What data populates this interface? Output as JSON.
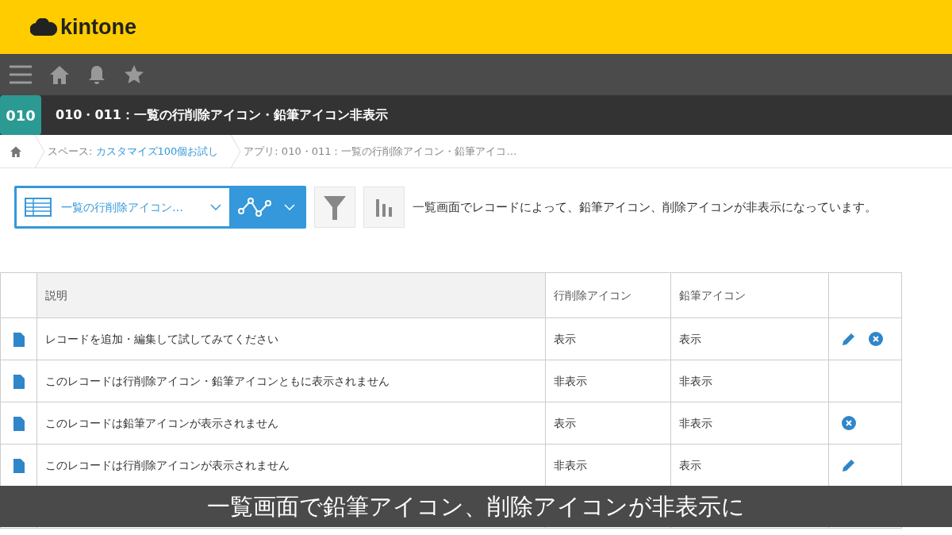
{
  "brand": "kintone",
  "app": {
    "badge": "010",
    "title": "010・011：一覧の行削除アイコン・鉛筆アイコン非表示"
  },
  "breadcrumb": [
    {
      "prefix": "スペース: ",
      "link": "カスタマイズ100個お試し"
    },
    {
      "prefix": "アプリ: 010・011：一覧の行削除アイコン・鉛筆アイコ…"
    }
  ],
  "view": {
    "name": "一覧の行削除アイコン…",
    "description": "一覧画面でレコードによって、鉛筆アイコン、削除アイコンが非表示になっています。"
  },
  "table": {
    "columns": [
      "説明",
      "行削除アイコン",
      "鉛筆アイコン"
    ],
    "rows": [
      {
        "cells": [
          "レコードを追加・編集して試してみてください",
          "表示",
          "表示"
        ],
        "pencil": true,
        "delete": true
      },
      {
        "cells": [
          "このレコードは行削除アイコン・鉛筆アイコンともに表示されません",
          "非表示",
          "非表示"
        ],
        "pencil": false,
        "delete": false
      },
      {
        "cells": [
          "このレコードは鉛筆アイコンが表示されません",
          "表示",
          "非表示"
        ],
        "pencil": false,
        "delete": true
      },
      {
        "cells": [
          "このレコードは行削除アイコンが表示されません",
          "非表示",
          "表示"
        ],
        "pencil": true,
        "delete": false
      }
    ]
  },
  "subtitle": "一覧画面で鉛筆アイコン、削除アイコンが非表示に"
}
